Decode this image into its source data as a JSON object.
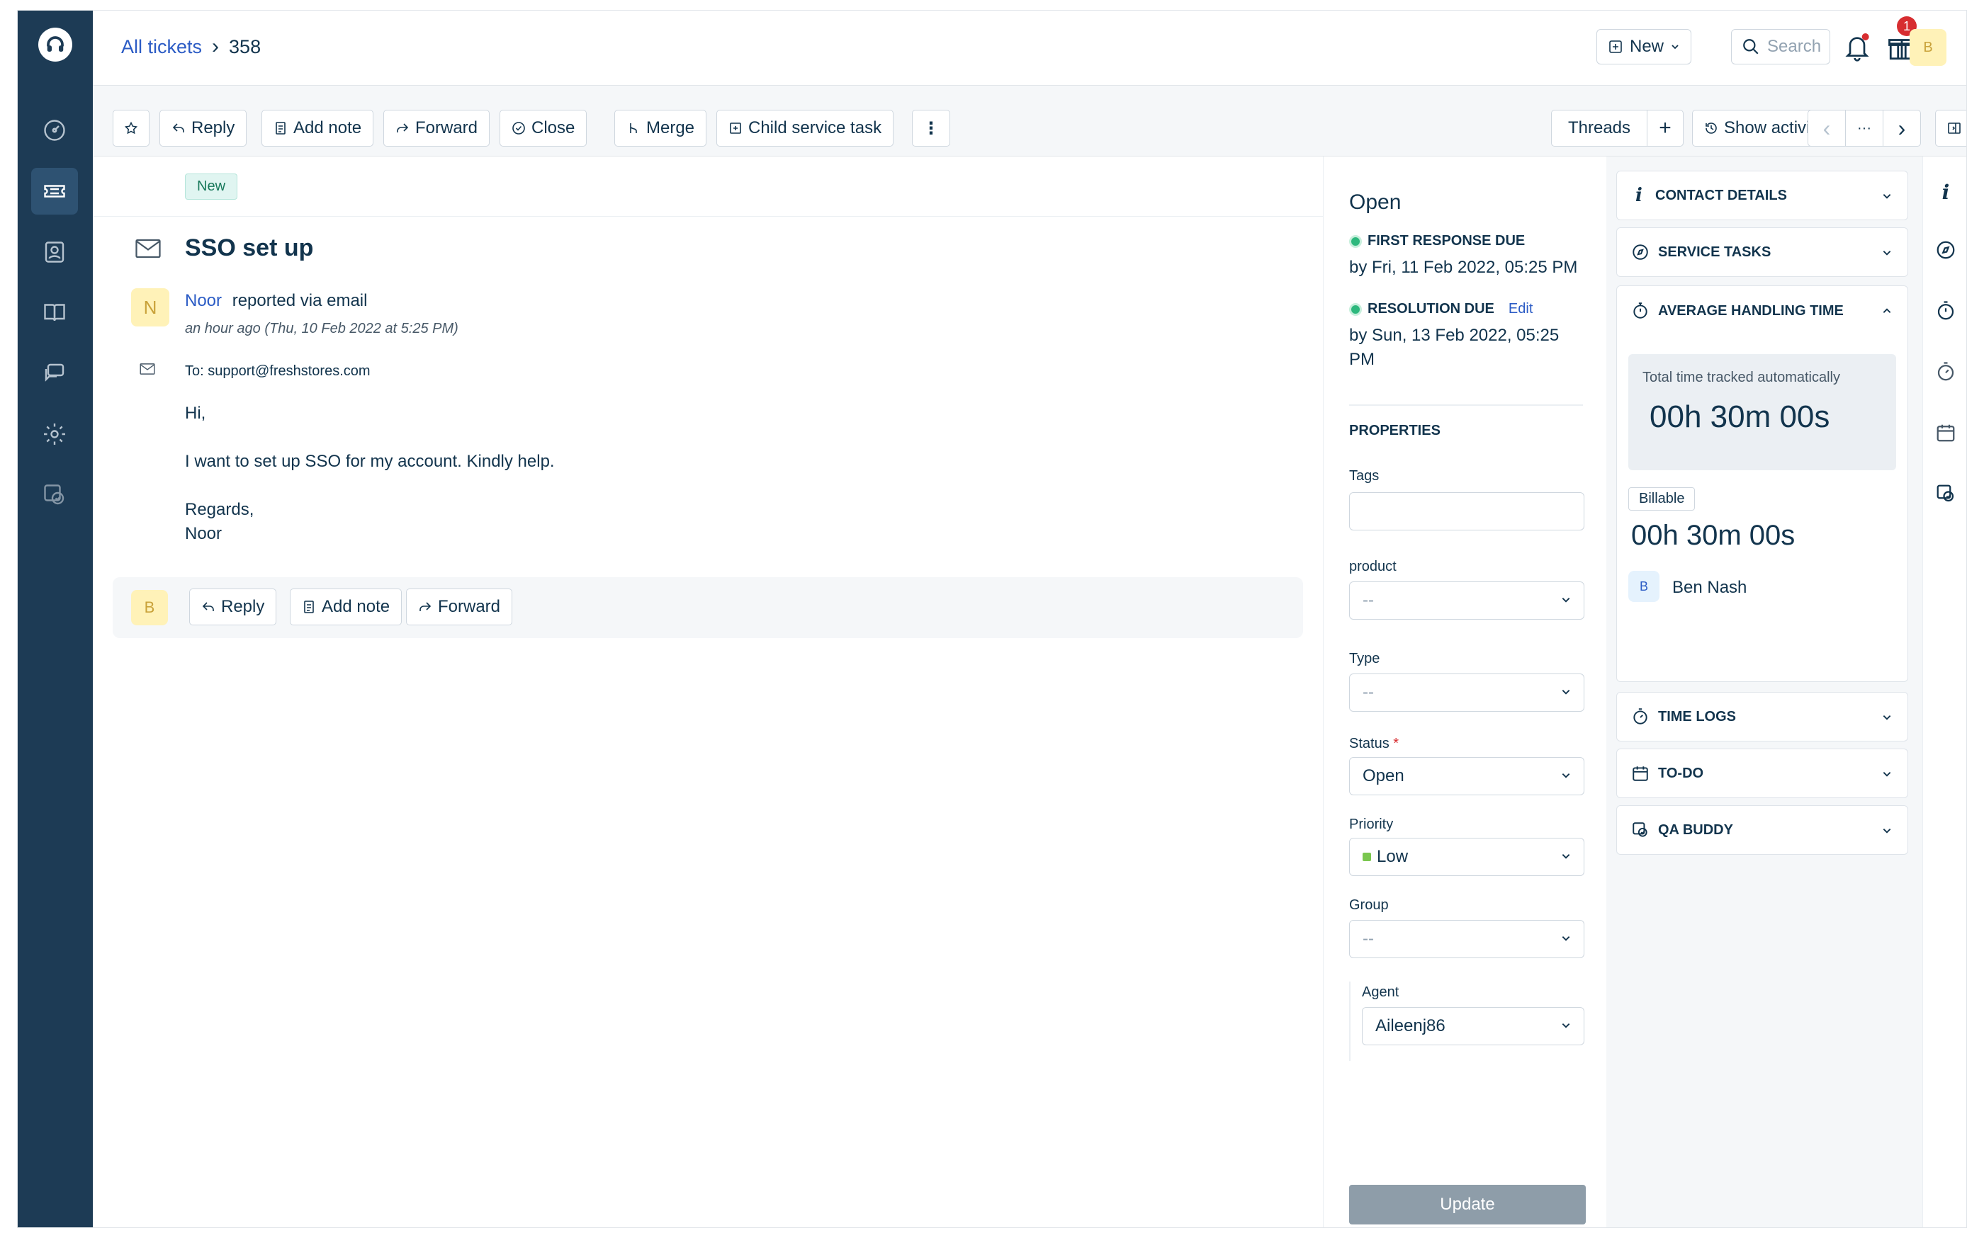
{
  "header": {
    "breadcrumb_link": "All tickets",
    "breadcrumb_sep": "›",
    "ticket_id": "358",
    "new_label": "New",
    "search_placeholder": "Search",
    "gift_badge": "1",
    "avatar_initial": "B"
  },
  "toolbar": {
    "reply": "Reply",
    "add_note": "Add note",
    "forward": "Forward",
    "close": "Close",
    "merge": "Merge",
    "child_task": "Child service task",
    "more": "⋮",
    "threads": "Threads",
    "add": "+",
    "show_activities": "Show activities",
    "prev": "‹",
    "ellipsis": "···",
    "next": "›"
  },
  "ticket": {
    "status_chip": "New",
    "subject": "SSO set up",
    "reporter_initial": "N",
    "reporter_name": "Noor",
    "reported_via": "reported via email",
    "when": "an hour ago (Thu, 10 Feb 2022 at 5:25 PM)",
    "to_label": "To:",
    "to_address": "support@freshstores.com",
    "body_greeting": "Hi,",
    "body_text": "I want to set up SSO for my account. Kindly help.",
    "body_regards": "Regards,",
    "body_sign": "Noor",
    "reply_avatar": "B",
    "reply": "Reply",
    "add_note": "Add note",
    "forward": "Forward"
  },
  "properties": {
    "status_title": "Open",
    "first_response_label": "FIRST RESPONSE DUE",
    "first_response_value": "by Fri, 11 Feb 2022, 05:25 PM",
    "resolution_label": "RESOLUTION DUE",
    "resolution_edit": "Edit",
    "resolution_value": "by Sun, 13 Feb 2022, 05:25 PM",
    "section_title": "PROPERTIES",
    "tags_label": "Tags",
    "product_label": "product",
    "product_value": "--",
    "type_label": "Type",
    "type_value": "--",
    "status_label": "Status",
    "status_required": "*",
    "status_value": "Open",
    "priority_label": "Priority",
    "priority_value": "Low",
    "priority_color": "#7ac74f",
    "group_label": "Group",
    "group_value": "--",
    "agent_label": "Agent",
    "agent_value": "Aileenj86",
    "update_label": "Update"
  },
  "right_panel": {
    "contact_details": "CONTACT DETAILS",
    "service_tasks": "SERVICE TASKS",
    "aht": "AVERAGE HANDLING TIME",
    "tracked_label": "Total time tracked automatically",
    "tracked_value": "00h 30m 00s",
    "billable_label": "Billable",
    "billable_value": "00h 30m 00s",
    "agent_initial": "B",
    "agent_name": "Ben Nash",
    "time_logs": "TIME LOGS",
    "todo": "TO-DO",
    "qa_buddy": "QA BUDDY"
  },
  "icons": {
    "sidebar": [
      "headset-logo-icon",
      "dashboard-icon",
      "tickets-icon",
      "contacts-icon",
      "knowledge-base-icon",
      "chat-icon",
      "settings-icon",
      "qa-icon"
    ]
  }
}
